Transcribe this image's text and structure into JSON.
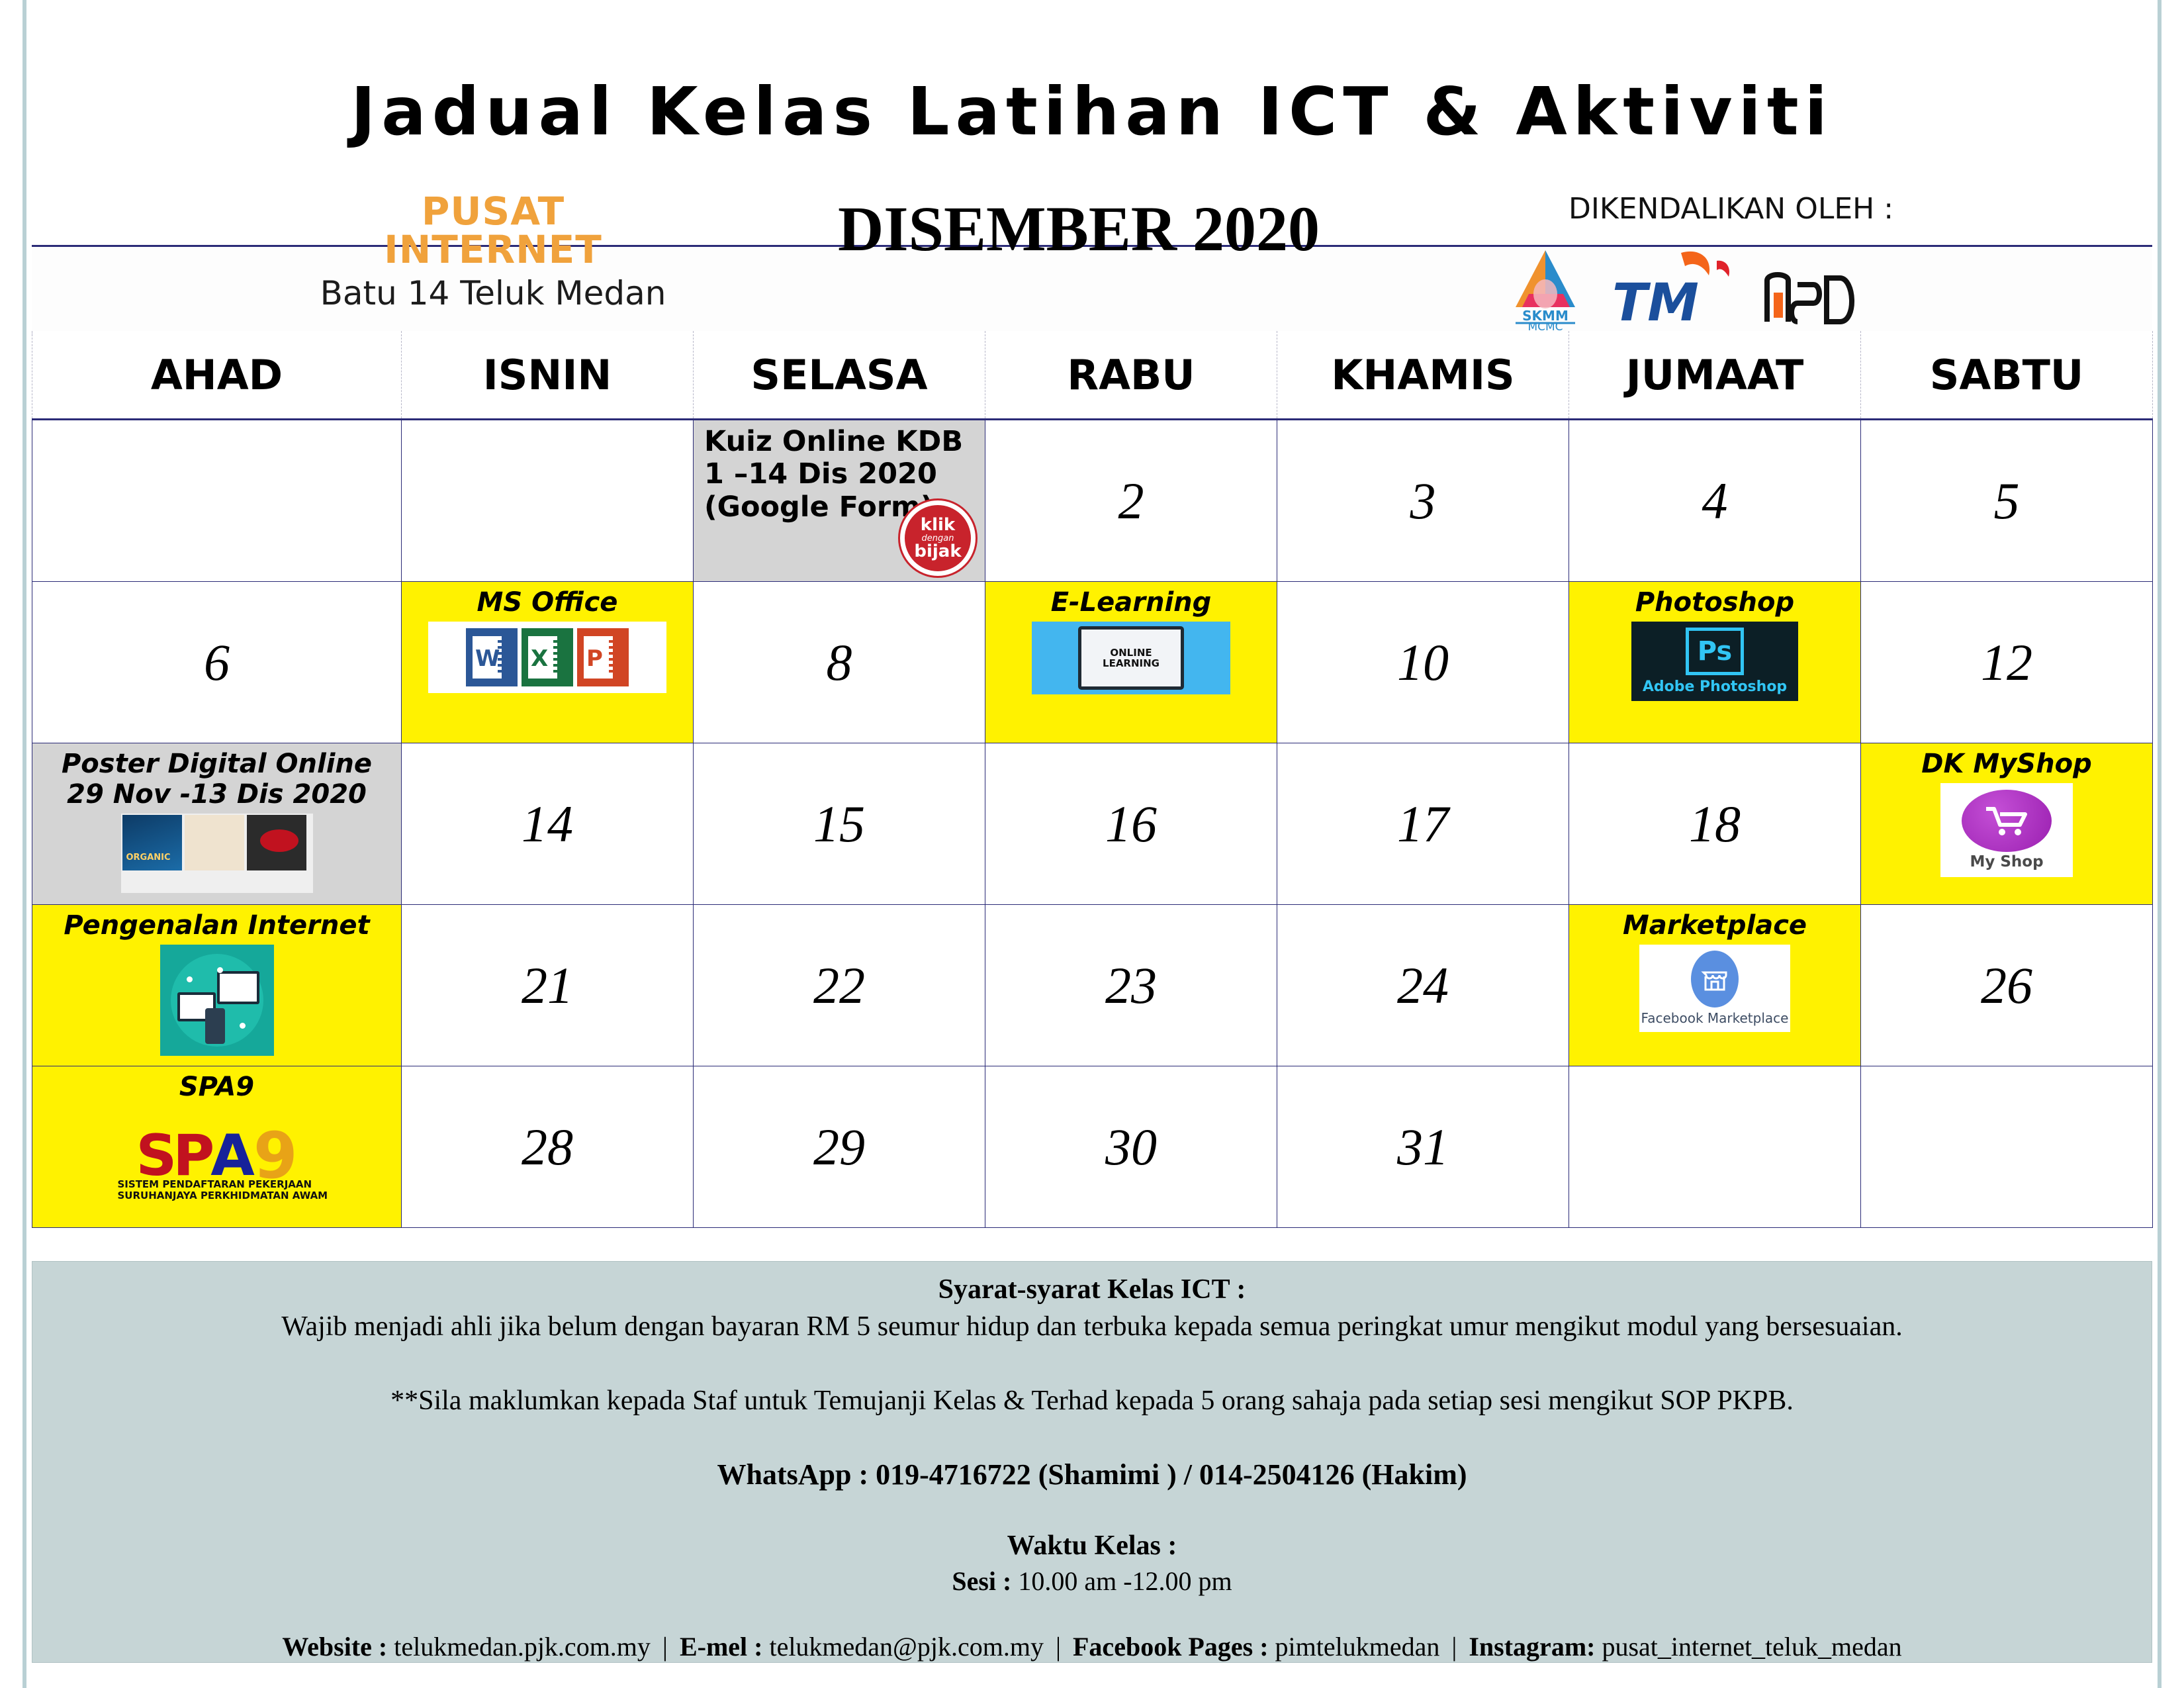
{
  "title": "Jadual Kelas Latihan ICT & Aktiviti",
  "brand": {
    "line1": "PUSAT INTERNET",
    "line2": "Batu 14 Teluk Medan",
    "brand_color": "#f0a23c"
  },
  "month": "DISEMBER 2020",
  "operated_by": {
    "label": "DIKENDALIKAN OLEH :",
    "logos": [
      "skmm-mcmc-logo",
      "tm-logo",
      "nsd-logo"
    ]
  },
  "calendar": {
    "day_headers": [
      "AHAD",
      "ISNIN",
      "SELASA",
      "RABU",
      "KHAMIS",
      "JUMAAT",
      "SABTU"
    ],
    "highlight_yellow": "#fff200",
    "highlight_grey": "#d4d4d4",
    "grid_color": "#2b2b77",
    "weeks": [
      [
        {
          "num": ""
        },
        {
          "num": ""
        },
        {
          "num": "",
          "event": "Kuiz Online KDB\n1 –14 Dis 2020\n(Google Form)",
          "style": "grey",
          "art": "klik-dengan-bijak-badge",
          "plain": true
        },
        {
          "num": "2"
        },
        {
          "num": "3"
        },
        {
          "num": "4"
        },
        {
          "num": "5"
        }
      ],
      [
        {
          "num": "6"
        },
        {
          "num": "",
          "event": "MS Office",
          "style": "yellow",
          "art": "ms-office-logo"
        },
        {
          "num": "8"
        },
        {
          "num": "",
          "event": "E-Learning",
          "style": "yellow",
          "art": "online-learning-monitor"
        },
        {
          "num": "10"
        },
        {
          "num": "",
          "event": "Photoshop",
          "style": "yellow",
          "art": "adobe-photoshop-logo"
        },
        {
          "num": "12"
        }
      ],
      [
        {
          "num": "",
          "event": "Poster Digital  Online\n29 Nov -13 Dis 2020",
          "style": "grey",
          "art": "poster-thumbnails"
        },
        {
          "num": "14"
        },
        {
          "num": "15"
        },
        {
          "num": "16"
        },
        {
          "num": "17"
        },
        {
          "num": "18"
        },
        {
          "num": "",
          "event": "DK MyShop",
          "style": "yellow",
          "art": "my-shop-logo"
        }
      ],
      [
        {
          "num": "",
          "event": "Pengenalan Internet",
          "style": "yellow",
          "art": "internet-illustration"
        },
        {
          "num": "21"
        },
        {
          "num": "22"
        },
        {
          "num": "23"
        },
        {
          "num": "24"
        },
        {
          "num": "",
          "event": "Marketplace",
          "style": "yellow",
          "art": "facebook-marketplace-logo"
        },
        {
          "num": "26"
        }
      ],
      [
        {
          "num": "",
          "event": "SPA9",
          "style": "yellow",
          "art": "spa9-logo"
        },
        {
          "num": "28"
        },
        {
          "num": "29"
        },
        {
          "num": "30"
        },
        {
          "num": "31"
        },
        {
          "num": ""
        },
        {
          "num": ""
        }
      ]
    ]
  },
  "art_text": {
    "ms_office": [
      "W",
      "X",
      "P"
    ],
    "elearning_caption": "ONLINE\nLEARNING",
    "photoshop_mark": "Ps",
    "photoshop_caption": "Adobe Photoshop",
    "myshop_caption": "My Shop",
    "marketplace_caption": "Facebook Marketplace",
    "spa9_mark_a": "SP",
    "spa9_mark_b": "A",
    "spa9_nine": "9",
    "spa9_sub": "SISTEM PENDAFTARAN PEKERJAAN\nSURUHANJAYA PERKHIDMATAN AWAM",
    "klik_line1": "klik",
    "klik_line2": "dengan",
    "klik_line3": "bijak"
  },
  "footer": {
    "heading": "Syarat-syarat Kelas ICT :",
    "condition": "Wajib menjadi ahli jika belum dengan bayaran RM 5 seumur hidup dan terbuka kepada semua peringkat umur mengikut modul yang bersesuaian.",
    "note": "**Sila maklumkan kepada Staf untuk Temujanji Kelas & Terhad kepada 5 orang sahaja pada setiap sesi mengikut SOP PKPB.",
    "whatsapp": "WhatsApp : 019-4716722 (Shamimi ) / 014-2504126 (Hakim)",
    "waktu_heading": "Waktu Kelas :",
    "sesi_label": "Sesi :",
    "sesi_value": "10.00 am -12.00 pm",
    "contact": {
      "website_label": "Website :",
      "website_value": "telukmedan.pjk.com.my",
      "email_label": "E-mel :",
      "email_value": "telukmedan@pjk.com.my",
      "facebook_label": "Facebook Pages :",
      "facebook_value": "pimtelukmedan",
      "instagram_label": "Instagram:",
      "instagram_value": "pusat_internet_teluk_medan"
    },
    "background": "#c6d5d6"
  }
}
